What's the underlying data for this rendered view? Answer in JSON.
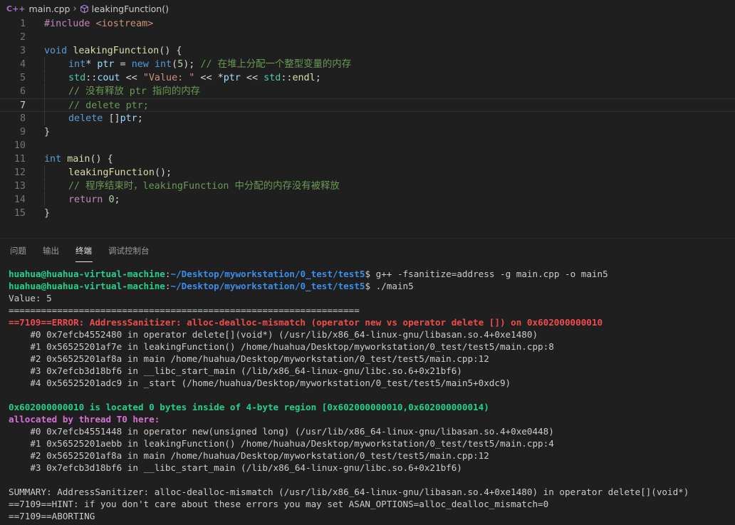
{
  "breadcrumb": {
    "file_icon": "C++",
    "file": "main.cpp",
    "symbol": "leakingFunction()"
  },
  "editor": {
    "current_line": 7,
    "line_numbers": [
      "1",
      "2",
      "3",
      "4",
      "5",
      "6",
      "7",
      "8",
      "9",
      "10",
      "11",
      "12",
      "13",
      "14",
      "15"
    ],
    "lines": [
      {
        "parts": [
          {
            "c": "pp",
            "t": "#include "
          },
          {
            "c": "str",
            "t": "<iostream>"
          }
        ]
      },
      {
        "parts": []
      },
      {
        "parts": [
          {
            "c": "kw",
            "t": "void "
          },
          {
            "c": "fn",
            "t": "leakingFunction"
          },
          {
            "c": "op",
            "t": "() {"
          }
        ]
      },
      {
        "indent": 1,
        "parts": [
          {
            "c": "kw",
            "t": "int"
          },
          {
            "c": "op",
            "t": "* "
          },
          {
            "c": "var",
            "t": "ptr"
          },
          {
            "c": "op",
            "t": " = "
          },
          {
            "c": "kw",
            "t": "new "
          },
          {
            "c": "kw",
            "t": "int"
          },
          {
            "c": "op",
            "t": "("
          },
          {
            "c": "num",
            "t": "5"
          },
          {
            "c": "op",
            "t": "); "
          },
          {
            "c": "cm",
            "t": "// 在堆上分配一个整型变量的内存"
          }
        ]
      },
      {
        "indent": 1,
        "parts": [
          {
            "c": "ty",
            "t": "std"
          },
          {
            "c": "op",
            "t": "::"
          },
          {
            "c": "var",
            "t": "cout"
          },
          {
            "c": "op",
            "t": " << "
          },
          {
            "c": "str",
            "t": "\"Value: \""
          },
          {
            "c": "op",
            "t": " << *"
          },
          {
            "c": "var",
            "t": "ptr"
          },
          {
            "c": "op",
            "t": " << "
          },
          {
            "c": "ty",
            "t": "std"
          },
          {
            "c": "op",
            "t": "::"
          },
          {
            "c": "fn",
            "t": "endl"
          },
          {
            "c": "op",
            "t": ";"
          }
        ]
      },
      {
        "indent": 1,
        "parts": [
          {
            "c": "cm",
            "t": "// 没有释放 ptr 指向的内存"
          }
        ]
      },
      {
        "indent": 1,
        "parts": [
          {
            "c": "cm",
            "t": "// delete ptr;"
          }
        ]
      },
      {
        "indent": 1,
        "parts": [
          {
            "c": "kw",
            "t": "delete "
          },
          {
            "c": "op",
            "t": "[]"
          },
          {
            "c": "var",
            "t": "ptr"
          },
          {
            "c": "op",
            "t": ";"
          }
        ]
      },
      {
        "parts": [
          {
            "c": "op",
            "t": "}"
          }
        ]
      },
      {
        "parts": []
      },
      {
        "parts": [
          {
            "c": "kw",
            "t": "int "
          },
          {
            "c": "fn",
            "t": "main"
          },
          {
            "c": "op",
            "t": "() {"
          }
        ]
      },
      {
        "indent": 1,
        "parts": [
          {
            "c": "fn",
            "t": "leakingFunction"
          },
          {
            "c": "op",
            "t": "();"
          }
        ]
      },
      {
        "indent": 1,
        "parts": [
          {
            "c": "cm",
            "t": "// 程序结束时，leakingFunction 中分配的内存没有被释放"
          }
        ]
      },
      {
        "indent": 1,
        "parts": [
          {
            "c": "kw2",
            "t": "return "
          },
          {
            "c": "num",
            "t": "0"
          },
          {
            "c": "op",
            "t": ";"
          }
        ]
      },
      {
        "parts": [
          {
            "c": "op",
            "t": "}"
          }
        ]
      }
    ]
  },
  "panel": {
    "tabs": [
      "问题",
      "输出",
      "终端",
      "调试控制台"
    ],
    "active_tab": "终端"
  },
  "terminal": {
    "lines": [
      {
        "parts": [
          {
            "c": "t-user",
            "t": "huahua@huahua-virtual-machine"
          },
          {
            "c": "",
            "t": ":"
          },
          {
            "c": "t-path",
            "t": "~/Desktop/myworkstation/0_test/test5"
          },
          {
            "c": "",
            "t": "$ g++ -fsanitize=address -g main.cpp -o main5"
          }
        ]
      },
      {
        "parts": [
          {
            "c": "t-user",
            "t": "huahua@huahua-virtual-machine"
          },
          {
            "c": "",
            "t": ":"
          },
          {
            "c": "t-path",
            "t": "~/Desktop/myworkstation/0_test/test5"
          },
          {
            "c": "",
            "t": "$ ./main5"
          }
        ]
      },
      {
        "parts": [
          {
            "c": "",
            "t": "Value: 5"
          }
        ]
      },
      {
        "parts": [
          {
            "c": "",
            "t": "================================================================="
          }
        ]
      },
      {
        "parts": [
          {
            "c": "t-err",
            "t": "==7109==ERROR: AddressSanitizer: alloc-dealloc-mismatch (operator new vs operator delete []) on 0x602000000010"
          }
        ]
      },
      {
        "parts": [
          {
            "c": "",
            "t": "    #0 0x7efcb4552480 in operator delete[](void*) (/usr/lib/x86_64-linux-gnu/libasan.so.4+0xe1480)"
          }
        ]
      },
      {
        "parts": [
          {
            "c": "",
            "t": "    #1 0x56525201af7e in leakingFunction() /home/huahua/Desktop/myworkstation/0_test/test5/main.cpp:8"
          }
        ]
      },
      {
        "parts": [
          {
            "c": "",
            "t": "    #2 0x56525201af8a in main /home/huahua/Desktop/myworkstation/0_test/test5/main.cpp:12"
          }
        ]
      },
      {
        "parts": [
          {
            "c": "",
            "t": "    #3 0x7efcb3d18bf6 in __libc_start_main (/lib/x86_64-linux-gnu/libc.so.6+0x21bf6)"
          }
        ]
      },
      {
        "parts": [
          {
            "c": "",
            "t": "    #4 0x56525201adc9 in _start (/home/huahua/Desktop/myworkstation/0_test/test5/main5+0xdc9)"
          }
        ]
      },
      {
        "parts": [
          {
            "c": "",
            "t": " "
          }
        ]
      },
      {
        "parts": [
          {
            "c": "t-green",
            "t": "0x602000000010 is located 0 bytes inside of 4-byte region [0x602000000010,0x602000000014)"
          }
        ]
      },
      {
        "parts": [
          {
            "c": "t-mag",
            "t": "allocated by thread T0 here:"
          }
        ]
      },
      {
        "parts": [
          {
            "c": "",
            "t": "    #0 0x7efcb4551448 in operator new(unsigned long) (/usr/lib/x86_64-linux-gnu/libasan.so.4+0xe0448)"
          }
        ]
      },
      {
        "parts": [
          {
            "c": "",
            "t": "    #1 0x56525201aebb in leakingFunction() /home/huahua/Desktop/myworkstation/0_test/test5/main.cpp:4"
          }
        ]
      },
      {
        "parts": [
          {
            "c": "",
            "t": "    #2 0x56525201af8a in main /home/huahua/Desktop/myworkstation/0_test/test5/main.cpp:12"
          }
        ]
      },
      {
        "parts": [
          {
            "c": "",
            "t": "    #3 0x7efcb3d18bf6 in __libc_start_main (/lib/x86_64-linux-gnu/libc.so.6+0x21bf6)"
          }
        ]
      },
      {
        "parts": [
          {
            "c": "",
            "t": " "
          }
        ]
      },
      {
        "parts": [
          {
            "c": "",
            "t": "SUMMARY: AddressSanitizer: alloc-dealloc-mismatch (/usr/lib/x86_64-linux-gnu/libasan.so.4+0xe1480) in operator delete[](void*)"
          }
        ]
      },
      {
        "parts": [
          {
            "c": "",
            "t": "==7109==HINT: if you don't care about these errors you may set ASAN_OPTIONS=alloc_dealloc_mismatch=0"
          }
        ]
      },
      {
        "parts": [
          {
            "c": "",
            "t": "==7109==ABORTING"
          }
        ]
      }
    ]
  }
}
